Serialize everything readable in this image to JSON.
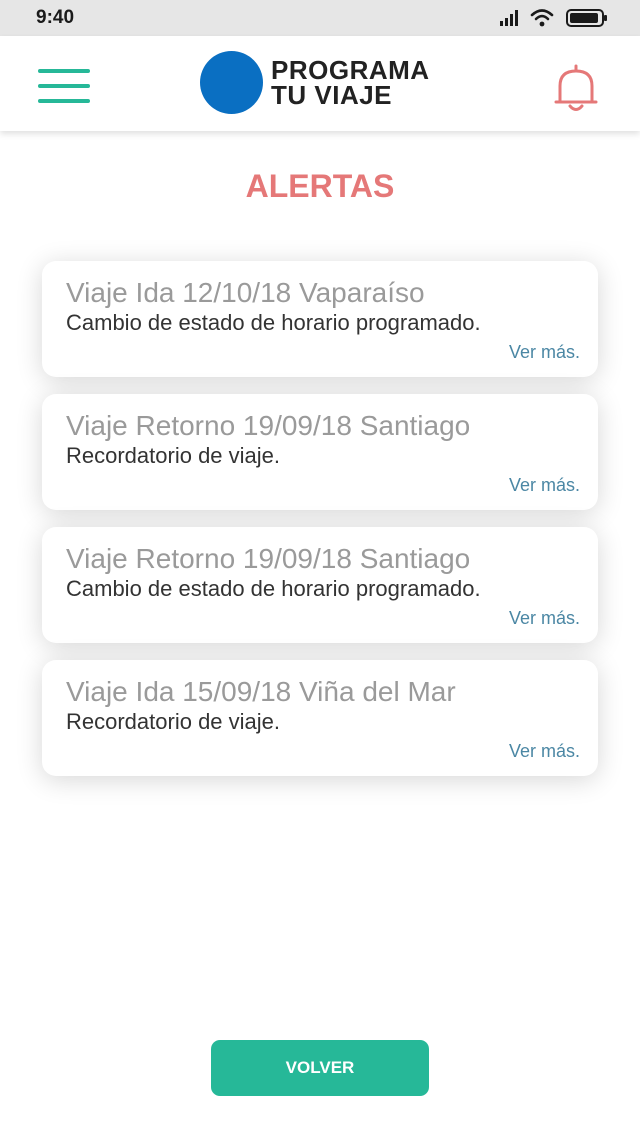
{
  "status_bar": {
    "time": "9:40",
    "icons": [
      "signal-icon",
      "wifi-icon",
      "battery-icon"
    ]
  },
  "header": {
    "brand_line1": "PROGRAMA",
    "brand_line2": "TU VIAJE",
    "menu_icon": "hamburger-menu-icon",
    "notification_icon": "bell-icon"
  },
  "page": {
    "title": "ALERTAS"
  },
  "alerts": [
    {
      "title": "Viaje Ida 12/10/18 Vaparaíso",
      "description": "Cambio de estado de horario programado.",
      "link": "Ver más."
    },
    {
      "title": "Viaje Retorno 19/09/18 Santiago",
      "description": "Recordatorio de viaje.",
      "link": "Ver más."
    },
    {
      "title": "Viaje Retorno 19/09/18 Santiago",
      "description": "Cambio de estado de horario programado.",
      "link": "Ver más."
    },
    {
      "title": "Viaje Ida 15/09/18 Viña del Mar",
      "description": "Recordatorio de viaje.",
      "link": "Ver más."
    }
  ],
  "footer": {
    "back_label": "VOLVER"
  },
  "colors": {
    "accent_green": "#26b898",
    "alert_red": "#e57878",
    "brand_blue": "#0a6fc2",
    "link_blue": "#4b87a4"
  }
}
